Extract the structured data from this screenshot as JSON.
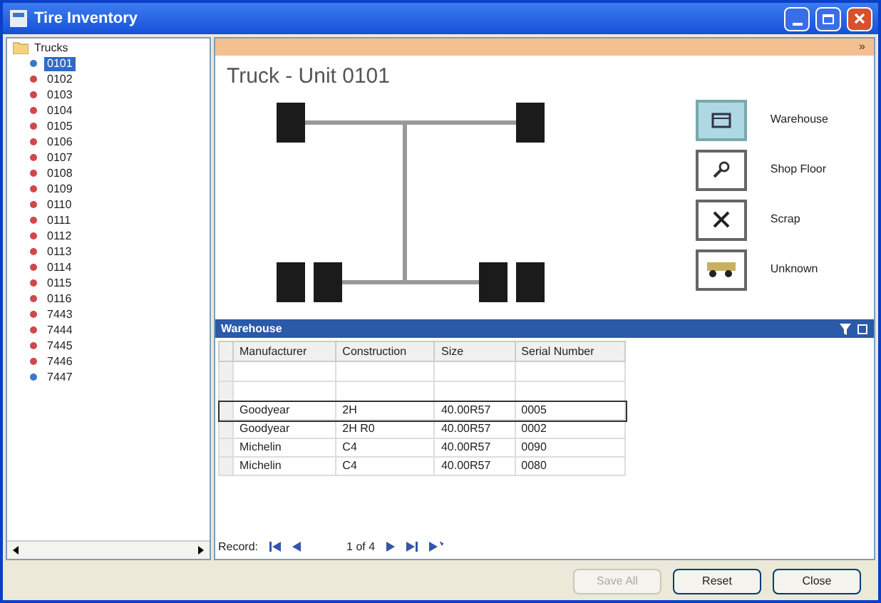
{
  "window": {
    "title": "Tire Inventory"
  },
  "tree": {
    "label": "Trucks",
    "expanded": true,
    "children": [
      {
        "label": "0101",
        "selected": true,
        "color": "#3a78c8"
      },
      {
        "label": "0102",
        "selected": false,
        "color": "#d04848"
      },
      {
        "label": "0103",
        "selected": false,
        "color": "#d04848"
      },
      {
        "label": "0104",
        "selected": false,
        "color": "#d04848"
      },
      {
        "label": "0105",
        "selected": false,
        "color": "#d04848"
      },
      {
        "label": "0106",
        "selected": false,
        "color": "#d04848"
      },
      {
        "label": "0107",
        "selected": false,
        "color": "#d04848"
      },
      {
        "label": "0108",
        "selected": false,
        "color": "#d04848"
      },
      {
        "label": "0109",
        "selected": false,
        "color": "#d04848"
      },
      {
        "label": "0110",
        "selected": false,
        "color": "#d04848"
      },
      {
        "label": "0111",
        "selected": false,
        "color": "#d04848"
      },
      {
        "label": "0112",
        "selected": false,
        "color": "#d04848"
      },
      {
        "label": "0113",
        "selected": false,
        "color": "#d04848"
      },
      {
        "label": "0114",
        "selected": false,
        "color": "#d04848"
      },
      {
        "label": "0115",
        "selected": false,
        "color": "#d04848"
      },
      {
        "label": "0116",
        "selected": false,
        "color": "#d04848"
      },
      {
        "label": "7443",
        "selected": false,
        "color": "#d04848"
      },
      {
        "label": "7444",
        "selected": false,
        "color": "#d04848"
      },
      {
        "label": "7445",
        "selected": false,
        "color": "#d04848"
      },
      {
        "label": "7446",
        "selected": false,
        "color": "#d04848"
      },
      {
        "label": "7447",
        "selected": false,
        "color": "#3a78c8"
      }
    ]
  },
  "header_bar": {
    "button": "»"
  },
  "unit_title": "Truck - Unit  0101",
  "locations": [
    {
      "kind": "warehouse",
      "label": "Warehouse",
      "selected": true
    },
    {
      "kind": "shop",
      "label": "Shop Floor",
      "selected": false
    },
    {
      "kind": "scrap",
      "label": "Scrap",
      "selected": false
    },
    {
      "kind": "unknown",
      "label": "Unknown",
      "selected": false
    }
  ],
  "grid": {
    "title": "Warehouse",
    "columns": [
      "Manufacturer",
      "Construction",
      "Size",
      "Serial Number"
    ],
    "rows": [
      {
        "cells": [
          "Goodyear",
          "2H",
          "40.00R57",
          "0005"
        ],
        "selected": true
      },
      {
        "cells": [
          "Goodyear",
          "2H R0",
          "40.00R57",
          "0002"
        ],
        "selected": false
      },
      {
        "cells": [
          "Michelin",
          "C4",
          "40.00R57",
          "0090"
        ],
        "selected": false
      },
      {
        "cells": [
          "Michelin",
          "C4",
          "40.00R57",
          "0080"
        ],
        "selected": false
      }
    ],
    "record_label": "Record:",
    "record_position": "1 of 4"
  },
  "buttons": [
    {
      "label": "Save All",
      "disabled": true
    },
    {
      "label": "Reset",
      "disabled": false
    },
    {
      "label": "Close",
      "disabled": false
    }
  ]
}
